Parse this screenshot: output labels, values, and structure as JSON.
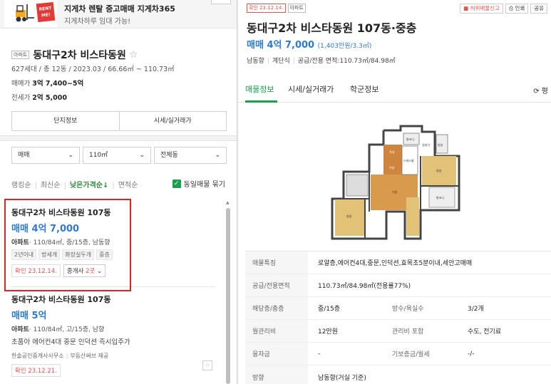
{
  "ad": {
    "badge": "RENT ME!",
    "title": "지게차 렌탈 중고매매 지게차365",
    "subtitle": "지게차하루 임대 가능!"
  },
  "complex": {
    "type_tag": "아파트",
    "name": "동대구2차 비스타동원",
    "star": "☆",
    "meta": "627세대 / 총 12동 / 2023.03 / 66.66㎡ ~ 110.73㎡",
    "sale_label": "매매가",
    "sale_value": "3억 7,400~5억",
    "jeonse_label": "전세가",
    "jeonse_value": "2억 5,000"
  },
  "tab_buttons": [
    "단지정보",
    "시세/실거래가"
  ],
  "filters": [
    {
      "value": "매매"
    },
    {
      "value": "110㎡"
    },
    {
      "value": "전체동"
    }
  ],
  "sort": {
    "options": [
      "랭킹순",
      "최신순",
      "낮은가격순↓",
      "면적순"
    ],
    "active_index": 2,
    "group_label": "동일매물 묶기",
    "group_checked": true
  },
  "listings": [
    {
      "name": "동대구2차 비스타동원 107동",
      "price": "매매 4억 7,000",
      "spec_type": "아파트",
      "spec": "· 110/84㎡, 중/15층, 남동향",
      "chips": [
        "2년이내",
        "방세개",
        "화장실두개",
        "중층"
      ],
      "confirm": "확인 23.12.14.",
      "agent_label": "중개사",
      "agent_count": "2곳"
    },
    {
      "name": "동대구2차 비스타동원 107동",
      "price": "매매 5억",
      "spec_type": "아파트",
      "spec": "· 110/84㎡, 고/15층, 남향",
      "desc": "초품아 에어컨4대 중문 인덕션 즉시입주가",
      "source_agent": "한솔공인중개사사무소",
      "source_provider": "부동산써브 제공",
      "confirm": "확인 23.12.21."
    }
  ],
  "detail": {
    "confirm_badge": "확인 23.12.14.",
    "type_badge": "아파트",
    "actions": [
      "허위매물신고",
      "인쇄",
      "공유"
    ],
    "title": "동대구2차 비스타동원 107동·중층",
    "price": "매매 4억 7,000",
    "price_per": "(1,403만원/3.3㎡)",
    "summary": [
      "남동향",
      "계단식",
      "공급/전용 면적:110.73㎡/84.98㎡"
    ],
    "tabs": [
      "매물정보",
      "시세/실거래가",
      "학군정보"
    ],
    "refresh": "⟳ 평",
    "plan_labels": [
      "발코니",
      "침실",
      "실외기",
      "욕실",
      "드레스룸",
      "주방",
      "거실",
      "침실",
      "침실",
      "발코니"
    ],
    "rows": [
      {
        "label": "매물특징",
        "value": "로얄층,에어컨4대,중문,인덕션,효목초5분이내,세안고매매"
      },
      {
        "label": "공급/전용면적",
        "value": "110.73㎡/84.98㎡(전용률77%)"
      },
      {
        "label": "해당층/총층",
        "value": "중/15층",
        "label2": "방수/욕실수",
        "value2": "3/2개"
      },
      {
        "label": "월관리비",
        "value": "12만원",
        "label2": "관리비 포함",
        "value2": "수도, 전기료"
      },
      {
        "label": "융자금",
        "value": "-",
        "label2": "기보증금/월세",
        "value2": "-/-"
      },
      {
        "label": "방향",
        "value": "남동향(거실 기준)"
      }
    ]
  },
  "colors": {
    "accent_green": "#19a14b",
    "price_blue": "#2c79d6",
    "confirm_red": "#e5544e",
    "highlight_red": "#e32323"
  }
}
